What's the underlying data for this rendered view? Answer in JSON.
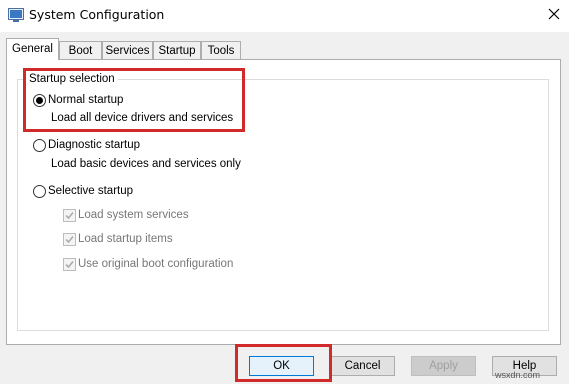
{
  "window": {
    "title": "System Configuration",
    "icon": "system-configuration-icon",
    "close_icon": "close-icon"
  },
  "tabs": [
    {
      "label": "General",
      "active": true
    },
    {
      "label": "Boot",
      "active": false
    },
    {
      "label": "Services",
      "active": false
    },
    {
      "label": "Startup",
      "active": false
    },
    {
      "label": "Tools",
      "active": false
    }
  ],
  "general": {
    "group_label": "Startup selection",
    "options": [
      {
        "label": "Normal startup",
        "desc": "Load all device drivers and services",
        "selected": true
      },
      {
        "label": "Diagnostic startup",
        "desc": "Load basic devices and services only",
        "selected": false
      },
      {
        "label": "Selective startup",
        "selected": false
      }
    ],
    "selective_items": [
      {
        "label": "Load system services",
        "checked": true,
        "enabled": false
      },
      {
        "label": "Load startup items",
        "checked": true,
        "enabled": false
      },
      {
        "label": "Use original boot configuration",
        "checked": true,
        "enabled": false
      }
    ]
  },
  "buttons": {
    "ok": "OK",
    "cancel": "Cancel",
    "apply": "Apply",
    "help": "Help"
  },
  "watermark": "wsxdn.com",
  "colors": {
    "highlight": "#d12a2a",
    "focus_border": "#0078d7"
  }
}
